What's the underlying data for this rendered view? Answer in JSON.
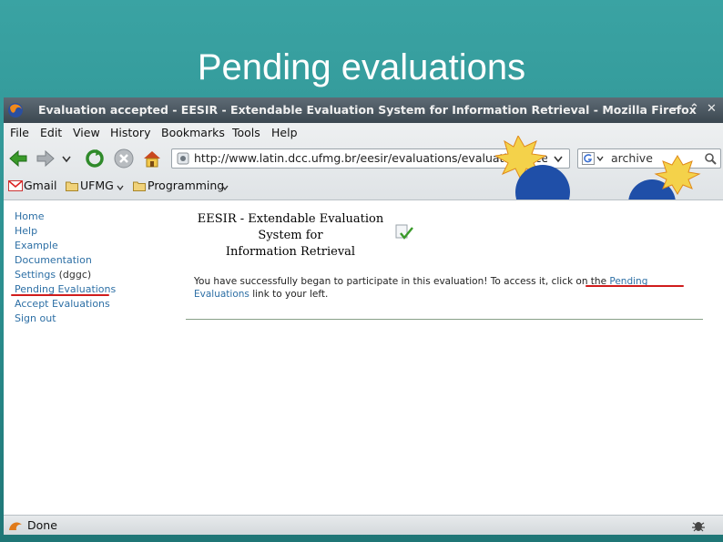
{
  "slide": {
    "title": "Pending evaluations"
  },
  "window": {
    "title": "Evaluation accepted - EESIR - Extendable Evaluation System for Information Retrieval - Mozilla Firefox",
    "minimize_glyph": "–",
    "maximize_glyph": "⌃",
    "close_glyph": "✕"
  },
  "menubar": {
    "items": [
      "File",
      "Edit",
      "View",
      "History",
      "Bookmarks",
      "Tools",
      "Help"
    ]
  },
  "navbar": {
    "url": "http://www.latin.dcc.ufmg.br/eesir/evaluations/evaluationAccepted",
    "search_value": "archive"
  },
  "bookmarks": {
    "items": [
      "Gmail",
      "UFMG",
      "Programming"
    ]
  },
  "sidebar": {
    "items": [
      "Home",
      "Help",
      "Example",
      "Documentation"
    ],
    "settings_label": "Settings",
    "settings_user": " (dggc)",
    "pending_label": "Pending Evaluations",
    "accept_label": "Accept Evaluations",
    "signout_label": "Sign out"
  },
  "page": {
    "header_line1": "EESIR - Extendable Evaluation",
    "header_line2": "System for",
    "header_line3": "Information Retrieval",
    "message_before": "You have successfully began to participate in this evaluation! To access it, click on the ",
    "message_link": "Pending Evaluations",
    "message_after": " link to your left."
  },
  "status": {
    "text": "Done"
  },
  "colors": {
    "accent_teal": "#2b8e8e",
    "link_blue": "#2d6fa5",
    "highlight_red": "#d01c1c"
  }
}
